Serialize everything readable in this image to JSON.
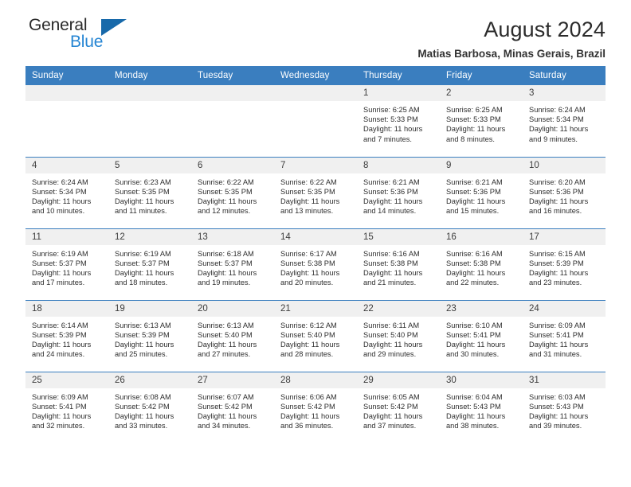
{
  "brand": {
    "name_top": "General",
    "name_bottom": "Blue",
    "accent_color": "#2585d3",
    "triangle_color": "#1769aa"
  },
  "header": {
    "title": "August 2024",
    "subtitle": "Matias Barbosa, Minas Gerais, Brazil"
  },
  "calendar": {
    "header_color": "#3a7ebf",
    "daynum_band_color": "#f0f0f0",
    "weekday_headers": [
      "Sunday",
      "Monday",
      "Tuesday",
      "Wednesday",
      "Thursday",
      "Friday",
      "Saturday"
    ],
    "labels": {
      "sunrise": "Sunrise:",
      "sunset": "Sunset:",
      "daylight": "Daylight:"
    },
    "weeks": [
      [
        {
          "day": "",
          "empty": true
        },
        {
          "day": "",
          "empty": true
        },
        {
          "day": "",
          "empty": true
        },
        {
          "day": "",
          "empty": true
        },
        {
          "day": "1",
          "sunrise": "Sunrise: 6:25 AM",
          "sunset": "Sunset: 5:33 PM",
          "daylight_line1": "Daylight: 11 hours",
          "daylight_line2": "and 7 minutes."
        },
        {
          "day": "2",
          "sunrise": "Sunrise: 6:25 AM",
          "sunset": "Sunset: 5:33 PM",
          "daylight_line1": "Daylight: 11 hours",
          "daylight_line2": "and 8 minutes."
        },
        {
          "day": "3",
          "sunrise": "Sunrise: 6:24 AM",
          "sunset": "Sunset: 5:34 PM",
          "daylight_line1": "Daylight: 11 hours",
          "daylight_line2": "and 9 minutes."
        }
      ],
      [
        {
          "day": "4",
          "sunrise": "Sunrise: 6:24 AM",
          "sunset": "Sunset: 5:34 PM",
          "daylight_line1": "Daylight: 11 hours",
          "daylight_line2": "and 10 minutes."
        },
        {
          "day": "5",
          "sunrise": "Sunrise: 6:23 AM",
          "sunset": "Sunset: 5:35 PM",
          "daylight_line1": "Daylight: 11 hours",
          "daylight_line2": "and 11 minutes."
        },
        {
          "day": "6",
          "sunrise": "Sunrise: 6:22 AM",
          "sunset": "Sunset: 5:35 PM",
          "daylight_line1": "Daylight: 11 hours",
          "daylight_line2": "and 12 minutes."
        },
        {
          "day": "7",
          "sunrise": "Sunrise: 6:22 AM",
          "sunset": "Sunset: 5:35 PM",
          "daylight_line1": "Daylight: 11 hours",
          "daylight_line2": "and 13 minutes."
        },
        {
          "day": "8",
          "sunrise": "Sunrise: 6:21 AM",
          "sunset": "Sunset: 5:36 PM",
          "daylight_line1": "Daylight: 11 hours",
          "daylight_line2": "and 14 minutes."
        },
        {
          "day": "9",
          "sunrise": "Sunrise: 6:21 AM",
          "sunset": "Sunset: 5:36 PM",
          "daylight_line1": "Daylight: 11 hours",
          "daylight_line2": "and 15 minutes."
        },
        {
          "day": "10",
          "sunrise": "Sunrise: 6:20 AM",
          "sunset": "Sunset: 5:36 PM",
          "daylight_line1": "Daylight: 11 hours",
          "daylight_line2": "and 16 minutes."
        }
      ],
      [
        {
          "day": "11",
          "sunrise": "Sunrise: 6:19 AM",
          "sunset": "Sunset: 5:37 PM",
          "daylight_line1": "Daylight: 11 hours",
          "daylight_line2": "and 17 minutes."
        },
        {
          "day": "12",
          "sunrise": "Sunrise: 6:19 AM",
          "sunset": "Sunset: 5:37 PM",
          "daylight_line1": "Daylight: 11 hours",
          "daylight_line2": "and 18 minutes."
        },
        {
          "day": "13",
          "sunrise": "Sunrise: 6:18 AM",
          "sunset": "Sunset: 5:37 PM",
          "daylight_line1": "Daylight: 11 hours",
          "daylight_line2": "and 19 minutes."
        },
        {
          "day": "14",
          "sunrise": "Sunrise: 6:17 AM",
          "sunset": "Sunset: 5:38 PM",
          "daylight_line1": "Daylight: 11 hours",
          "daylight_line2": "and 20 minutes."
        },
        {
          "day": "15",
          "sunrise": "Sunrise: 6:16 AM",
          "sunset": "Sunset: 5:38 PM",
          "daylight_line1": "Daylight: 11 hours",
          "daylight_line2": "and 21 minutes."
        },
        {
          "day": "16",
          "sunrise": "Sunrise: 6:16 AM",
          "sunset": "Sunset: 5:38 PM",
          "daylight_line1": "Daylight: 11 hours",
          "daylight_line2": "and 22 minutes."
        },
        {
          "day": "17",
          "sunrise": "Sunrise: 6:15 AM",
          "sunset": "Sunset: 5:39 PM",
          "daylight_line1": "Daylight: 11 hours",
          "daylight_line2": "and 23 minutes."
        }
      ],
      [
        {
          "day": "18",
          "sunrise": "Sunrise: 6:14 AM",
          "sunset": "Sunset: 5:39 PM",
          "daylight_line1": "Daylight: 11 hours",
          "daylight_line2": "and 24 minutes."
        },
        {
          "day": "19",
          "sunrise": "Sunrise: 6:13 AM",
          "sunset": "Sunset: 5:39 PM",
          "daylight_line1": "Daylight: 11 hours",
          "daylight_line2": "and 25 minutes."
        },
        {
          "day": "20",
          "sunrise": "Sunrise: 6:13 AM",
          "sunset": "Sunset: 5:40 PM",
          "daylight_line1": "Daylight: 11 hours",
          "daylight_line2": "and 27 minutes."
        },
        {
          "day": "21",
          "sunrise": "Sunrise: 6:12 AM",
          "sunset": "Sunset: 5:40 PM",
          "daylight_line1": "Daylight: 11 hours",
          "daylight_line2": "and 28 minutes."
        },
        {
          "day": "22",
          "sunrise": "Sunrise: 6:11 AM",
          "sunset": "Sunset: 5:40 PM",
          "daylight_line1": "Daylight: 11 hours",
          "daylight_line2": "and 29 minutes."
        },
        {
          "day": "23",
          "sunrise": "Sunrise: 6:10 AM",
          "sunset": "Sunset: 5:41 PM",
          "daylight_line1": "Daylight: 11 hours",
          "daylight_line2": "and 30 minutes."
        },
        {
          "day": "24",
          "sunrise": "Sunrise: 6:09 AM",
          "sunset": "Sunset: 5:41 PM",
          "daylight_line1": "Daylight: 11 hours",
          "daylight_line2": "and 31 minutes."
        }
      ],
      [
        {
          "day": "25",
          "sunrise": "Sunrise: 6:09 AM",
          "sunset": "Sunset: 5:41 PM",
          "daylight_line1": "Daylight: 11 hours",
          "daylight_line2": "and 32 minutes."
        },
        {
          "day": "26",
          "sunrise": "Sunrise: 6:08 AM",
          "sunset": "Sunset: 5:42 PM",
          "daylight_line1": "Daylight: 11 hours",
          "daylight_line2": "and 33 minutes."
        },
        {
          "day": "27",
          "sunrise": "Sunrise: 6:07 AM",
          "sunset": "Sunset: 5:42 PM",
          "daylight_line1": "Daylight: 11 hours",
          "daylight_line2": "and 34 minutes."
        },
        {
          "day": "28",
          "sunrise": "Sunrise: 6:06 AM",
          "sunset": "Sunset: 5:42 PM",
          "daylight_line1": "Daylight: 11 hours",
          "daylight_line2": "and 36 minutes."
        },
        {
          "day": "29",
          "sunrise": "Sunrise: 6:05 AM",
          "sunset": "Sunset: 5:42 PM",
          "daylight_line1": "Daylight: 11 hours",
          "daylight_line2": "and 37 minutes."
        },
        {
          "day": "30",
          "sunrise": "Sunrise: 6:04 AM",
          "sunset": "Sunset: 5:43 PM",
          "daylight_line1": "Daylight: 11 hours",
          "daylight_line2": "and 38 minutes."
        },
        {
          "day": "31",
          "sunrise": "Sunrise: 6:03 AM",
          "sunset": "Sunset: 5:43 PM",
          "daylight_line1": "Daylight: 11 hours",
          "daylight_line2": "and 39 minutes."
        }
      ]
    ]
  }
}
